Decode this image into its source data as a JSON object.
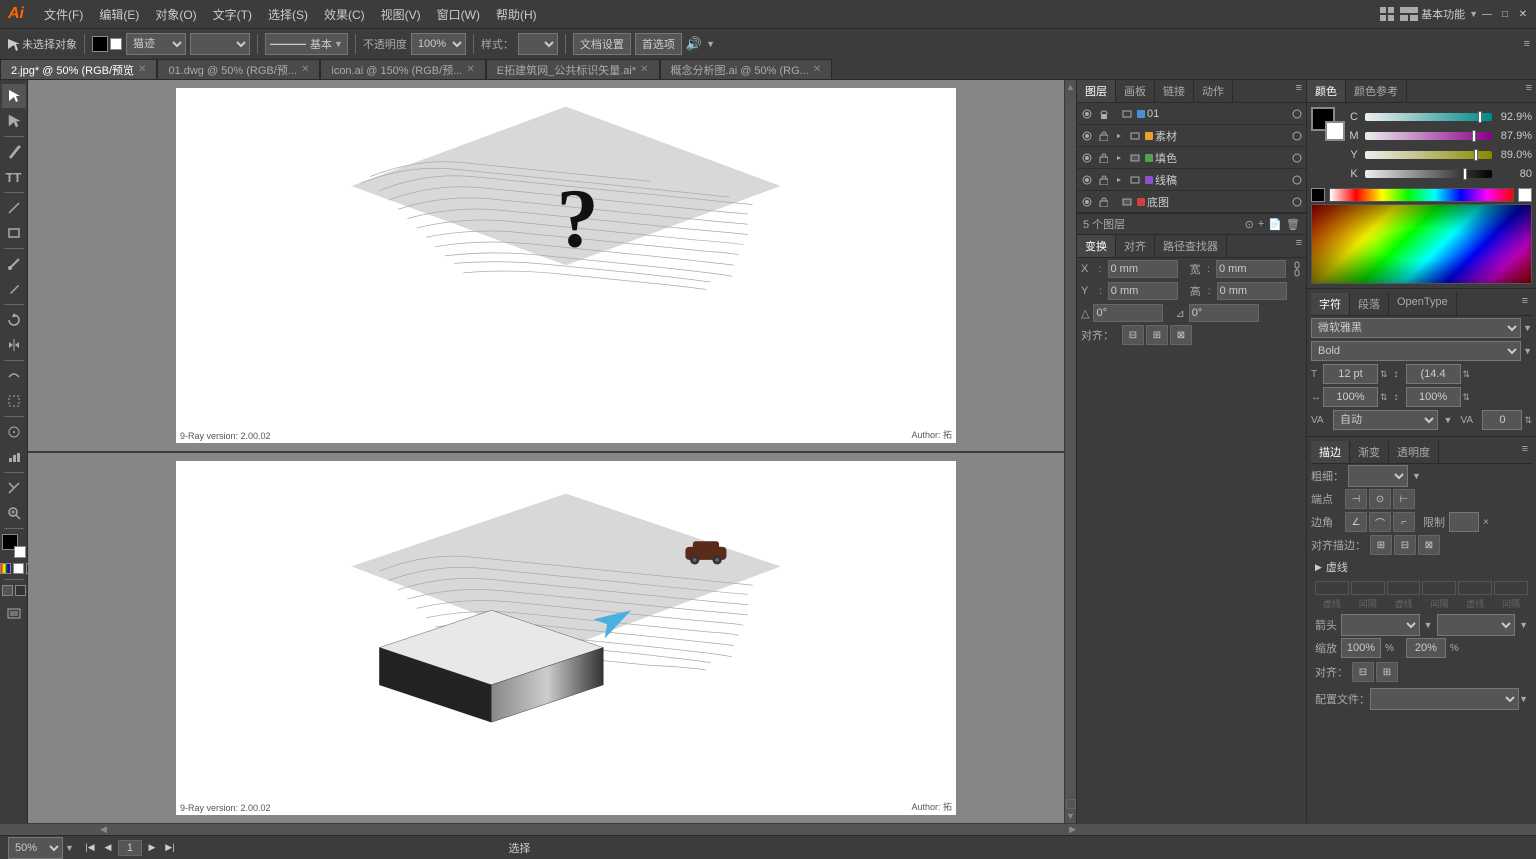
{
  "app": {
    "logo": "Ai",
    "title": "基本功能"
  },
  "menu": {
    "items": [
      "文件(F)",
      "编辑(E)",
      "对象(O)",
      "文字(T)",
      "选择(S)",
      "效果(C)",
      "视图(V)",
      "窗口(W)",
      "帮助(H)"
    ]
  },
  "toolbar": {
    "selection_label": "未选择对象",
    "stroke_label": "基本",
    "opacity_label": "不透明度",
    "opacity_value": "100%",
    "style_label": "样式：",
    "doc_settings": "文档设置",
    "first_page": "首选项",
    "mode_label": "猫迹"
  },
  "tabs": [
    {
      "label": "2.jpg* @ 50% (RGB/预览",
      "active": true
    },
    {
      "label": "01.dwg @ 50% (RGB/预..."
    },
    {
      "label": "icon.ai @ 150% (RGB/预..."
    },
    {
      "label": "E拓建筑网_公共标识矢量.ai*"
    },
    {
      "label": "概念分析图.ai @ 50% (RG..."
    }
  ],
  "layers": {
    "panel_tabs": [
      "图层",
      "画板",
      "链接",
      "动作"
    ],
    "active_tab": "图层",
    "items": [
      {
        "name": "01",
        "visible": true,
        "locked": false,
        "expand": false,
        "color": "#4a90d9"
      },
      {
        "name": "素材",
        "visible": true,
        "locked": false,
        "expand": true,
        "color": "#e8a030"
      },
      {
        "name": "填色",
        "visible": true,
        "locked": false,
        "expand": true,
        "color": "#50a050"
      },
      {
        "name": "线稿",
        "visible": true,
        "locked": false,
        "expand": true,
        "color": "#9050d0"
      },
      {
        "name": "底图",
        "visible": true,
        "locked": false,
        "expand": false,
        "color": "#d04040"
      }
    ],
    "count": "5 个图层",
    "bottom_icons": [
      "make-clipping-mask",
      "new-sublayer",
      "new-layer",
      "delete-layer"
    ]
  },
  "color": {
    "panel_tabs": [
      "颜色",
      "颜色参考"
    ],
    "active_tab": "颜色",
    "channels": [
      {
        "label": "C",
        "value": "92.9",
        "percent": true,
        "color_start": "#00ffff",
        "color_end": "#004444"
      },
      {
        "label": "M",
        "value": "87.9",
        "percent": true,
        "color_start": "#ff00ff",
        "color_end": "#440044"
      },
      {
        "label": "Y",
        "value": "89.0",
        "percent": true,
        "color_start": "#ffff00",
        "color_end": "#444400"
      },
      {
        "label": "K",
        "value": "80",
        "percent": true,
        "color_start": "#ffffff",
        "color_end": "#000000"
      }
    ]
  },
  "typography": {
    "panel_tabs": [
      "字符",
      "段落",
      "OpenType"
    ],
    "active_tab": "字符",
    "font_family": "微软雅黑",
    "font_style": "Bold",
    "font_size": "12 pt",
    "leading": "(14.4",
    "scale_h": "100%",
    "scale_v": "100%",
    "tracking": "自动",
    "kerning": "0"
  },
  "stroke": {
    "panel_tabs": [
      "描边",
      "渐变",
      "透明度"
    ],
    "active_tab": "描边",
    "weight_label": "粗细：",
    "cap_label": "端点",
    "corner_label": "边角",
    "limit_label": "限制",
    "align_label": "对齐描边：",
    "dashes_section": "虚线"
  },
  "transform": {
    "panel_tabs": [
      "变换",
      "对齐",
      "路径查找器"
    ],
    "active_tab": "变换",
    "x_label": "X",
    "x_value": "0 mm",
    "y_label": "Y",
    "y_value": "0 mm",
    "width_label": "宽",
    "width_value": "0 mm",
    "height_label": "高",
    "height_value": "0 mm",
    "angle_label": "角度",
    "angle_value": "0°",
    "shear_label": "切变",
    "shear_value": "0°",
    "align_label": "对齐："
  },
  "bottom_bar": {
    "zoom_value": "50%",
    "status_text": "选择",
    "page_current": "1"
  },
  "canvas": {
    "top_panel": {
      "label": "9-Ray version: 2.00.02",
      "author": "Author: 拓"
    },
    "bottom_panel": {
      "label": "9-Ray version: 2.00.02",
      "author": "Author: 拓"
    }
  }
}
